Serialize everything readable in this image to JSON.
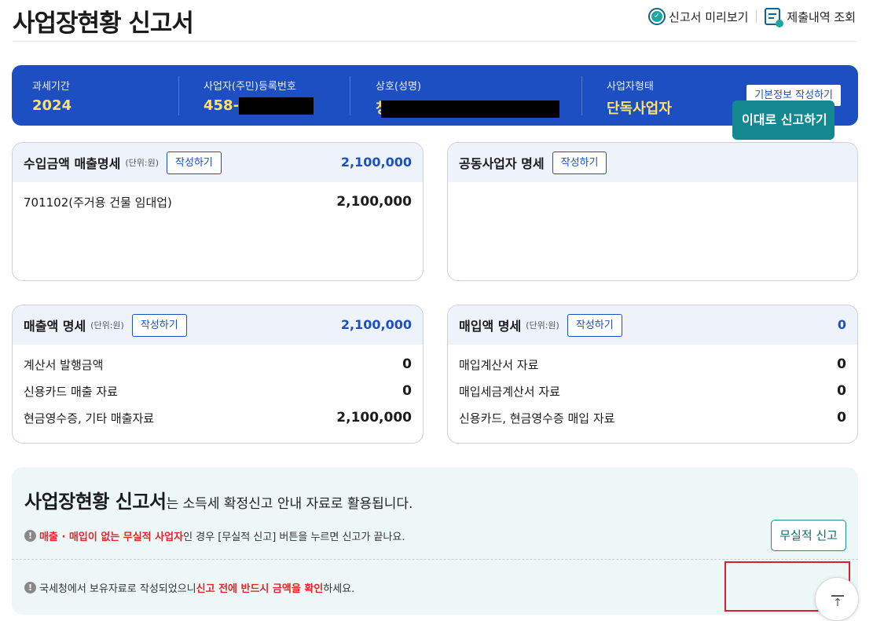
{
  "page": {
    "title": "사업장현황 신고서"
  },
  "top_links": {
    "preview": "신고서 미리보기",
    "history": "제출내역 조회"
  },
  "banner": {
    "tax_period_label": "과세기간",
    "tax_period_value": "2024",
    "reg_no_label": "사업자(주민)등록번호",
    "reg_no_value": "458-",
    "trade_name_label": "상호(성명)",
    "trade_name_value": "청",
    "biz_type_label": "사업자형태",
    "biz_type_value": "단독사업자",
    "info_button": "기본정보 작성하기"
  },
  "unit_text": "(단위:원)",
  "edit_label": "작성하기",
  "cards": {
    "income": {
      "title": "수입금액 매출명세",
      "total": "2,100,000",
      "rows": [
        {
          "label": "701102(주거용 건물 임대업)",
          "amount": "2,100,000"
        }
      ]
    },
    "partner": {
      "title": "공동사업자 명세"
    },
    "sales": {
      "title": "매출액 명세",
      "total": "2,100,000",
      "rows": [
        {
          "label": "계산서 발행금액",
          "amount": "0"
        },
        {
          "label": "신용카드 매출 자료",
          "amount": "0"
        },
        {
          "label": "현금영수증, 기타 매출자료",
          "amount": "2,100,000"
        }
      ]
    },
    "purchase": {
      "title": "매입액 명세",
      "total": "0",
      "rows": [
        {
          "label": "매입계산서 자료",
          "amount": "0"
        },
        {
          "label": "매입세금계산서 자료",
          "amount": "0"
        },
        {
          "label": "신용카드, 현금영수증 매입 자료",
          "amount": "0"
        }
      ]
    }
  },
  "bottom": {
    "heading_bold": "사업장현황 신고서",
    "heading_rest": "는 소득세 확정신고 안내 자료로 활용됩니다.",
    "notice1_red": "매출 · 매입이 없는 무실적 사업자",
    "notice1_rest": "인 경우 [무실적 신고] 버튼을 누르면 신고가 끝나요.",
    "notice2_pre": "국세청에서 보유자료로 작성되었으니 ",
    "notice2_red": "신고 전에 반드시 금액을 확인",
    "notice2_post": "하세요.",
    "nil_button": "무실적 신고",
    "submit_button": "이대로 신고하기"
  }
}
